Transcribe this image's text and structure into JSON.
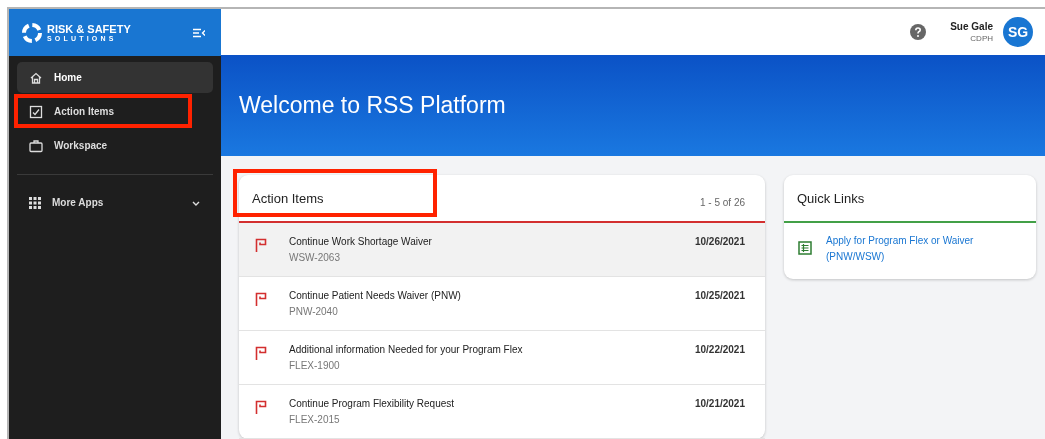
{
  "brand": {
    "line_1": "RISK & SAFETY",
    "line_2": "SOLUTIONS"
  },
  "sidebar": {
    "items": [
      {
        "label": "Home",
        "kind": "home",
        "selected": true,
        "highlighted": false
      },
      {
        "label": "Action Items",
        "kind": "tasks",
        "selected": false,
        "highlighted": true
      },
      {
        "label": "Workspace",
        "kind": "workspace",
        "selected": false,
        "highlighted": false
      }
    ],
    "more": {
      "label": "More Apps",
      "expanded": false
    }
  },
  "user": {
    "name": "Sue Gale",
    "org": "CDPH",
    "initials": "SG"
  },
  "banner": {
    "title": "Welcome to RSS Platform"
  },
  "action_items": {
    "title": "Action Items",
    "highlighted": true,
    "range": "1 - 5 of 26",
    "rows": [
      {
        "title": "Continue Work Shortage Waiver",
        "code": "WSW-2063",
        "date": "10/26/2021",
        "selected": true
      },
      {
        "title": "Continue Patient Needs Waiver (PNW)",
        "code": "PNW-2040",
        "date": "10/25/2021",
        "selected": false
      },
      {
        "title": "Additional information Needed for your Program Flex",
        "code": "FLEX-1900",
        "date": "10/22/2021",
        "selected": false
      },
      {
        "title": "Continue Program Flexibility Request",
        "code": "FLEX-2015",
        "date": "10/21/2021",
        "selected": false
      }
    ]
  },
  "quick_links": {
    "title": "Quick Links",
    "links": [
      "Apply for Program Flex or Waiver (PNW/WSW)"
    ]
  }
}
